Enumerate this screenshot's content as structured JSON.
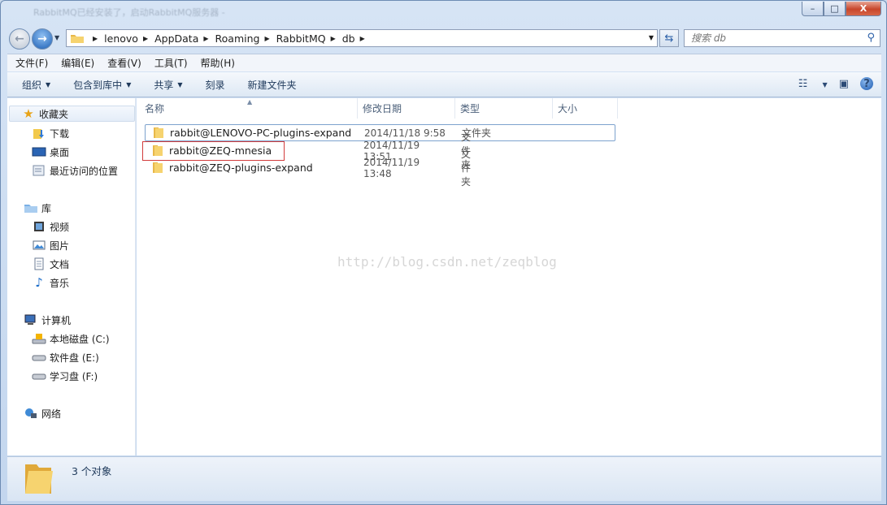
{
  "window": {
    "ghost_title": "RabbitMQ已经安装了，启动RabbitMQ服务器 -",
    "controls": {
      "minimize": "–",
      "maximize": "□",
      "close": "X"
    }
  },
  "address": {
    "crumbs": [
      "lenovo",
      "AppData",
      "Roaming",
      "RabbitMQ",
      "db"
    ],
    "search_placeholder": "搜索 db"
  },
  "menu": [
    "文件(F)",
    "编辑(E)",
    "查看(V)",
    "工具(T)",
    "帮助(H)"
  ],
  "commands": [
    "组织",
    "包含到库中",
    "共享",
    "刻录",
    "新建文件夹"
  ],
  "nav": {
    "favorites": "收藏夹",
    "fav_items": [
      "下载",
      "桌面",
      "最近访问的位置"
    ],
    "libraries": "库",
    "lib_items": [
      "视频",
      "图片",
      "文档",
      "音乐"
    ],
    "computer": "计算机",
    "drives": [
      "本地磁盘 (C:)",
      "软件盘 (E:)",
      "学习盘 (F:)"
    ],
    "network": "网络"
  },
  "columns": {
    "name": "名称",
    "date": "修改日期",
    "type": "类型",
    "size": "大小"
  },
  "files": [
    {
      "name": "rabbit@LENOVO-PC-plugins-expand",
      "date": "2014/11/18 9:58",
      "type": "文件夹"
    },
    {
      "name": "rabbit@ZEQ-mnesia",
      "date": "2014/11/19 13:51",
      "type": "文件夹"
    },
    {
      "name": "rabbit@ZEQ-plugins-expand",
      "date": "2014/11/19 13:48",
      "type": "文件夹"
    }
  ],
  "watermark": "http://blog.csdn.net/zeqblog",
  "status": {
    "count": "3 个对象"
  },
  "colors": {
    "highlight_box": "#d23c3c",
    "folder": "#f2c94c"
  }
}
